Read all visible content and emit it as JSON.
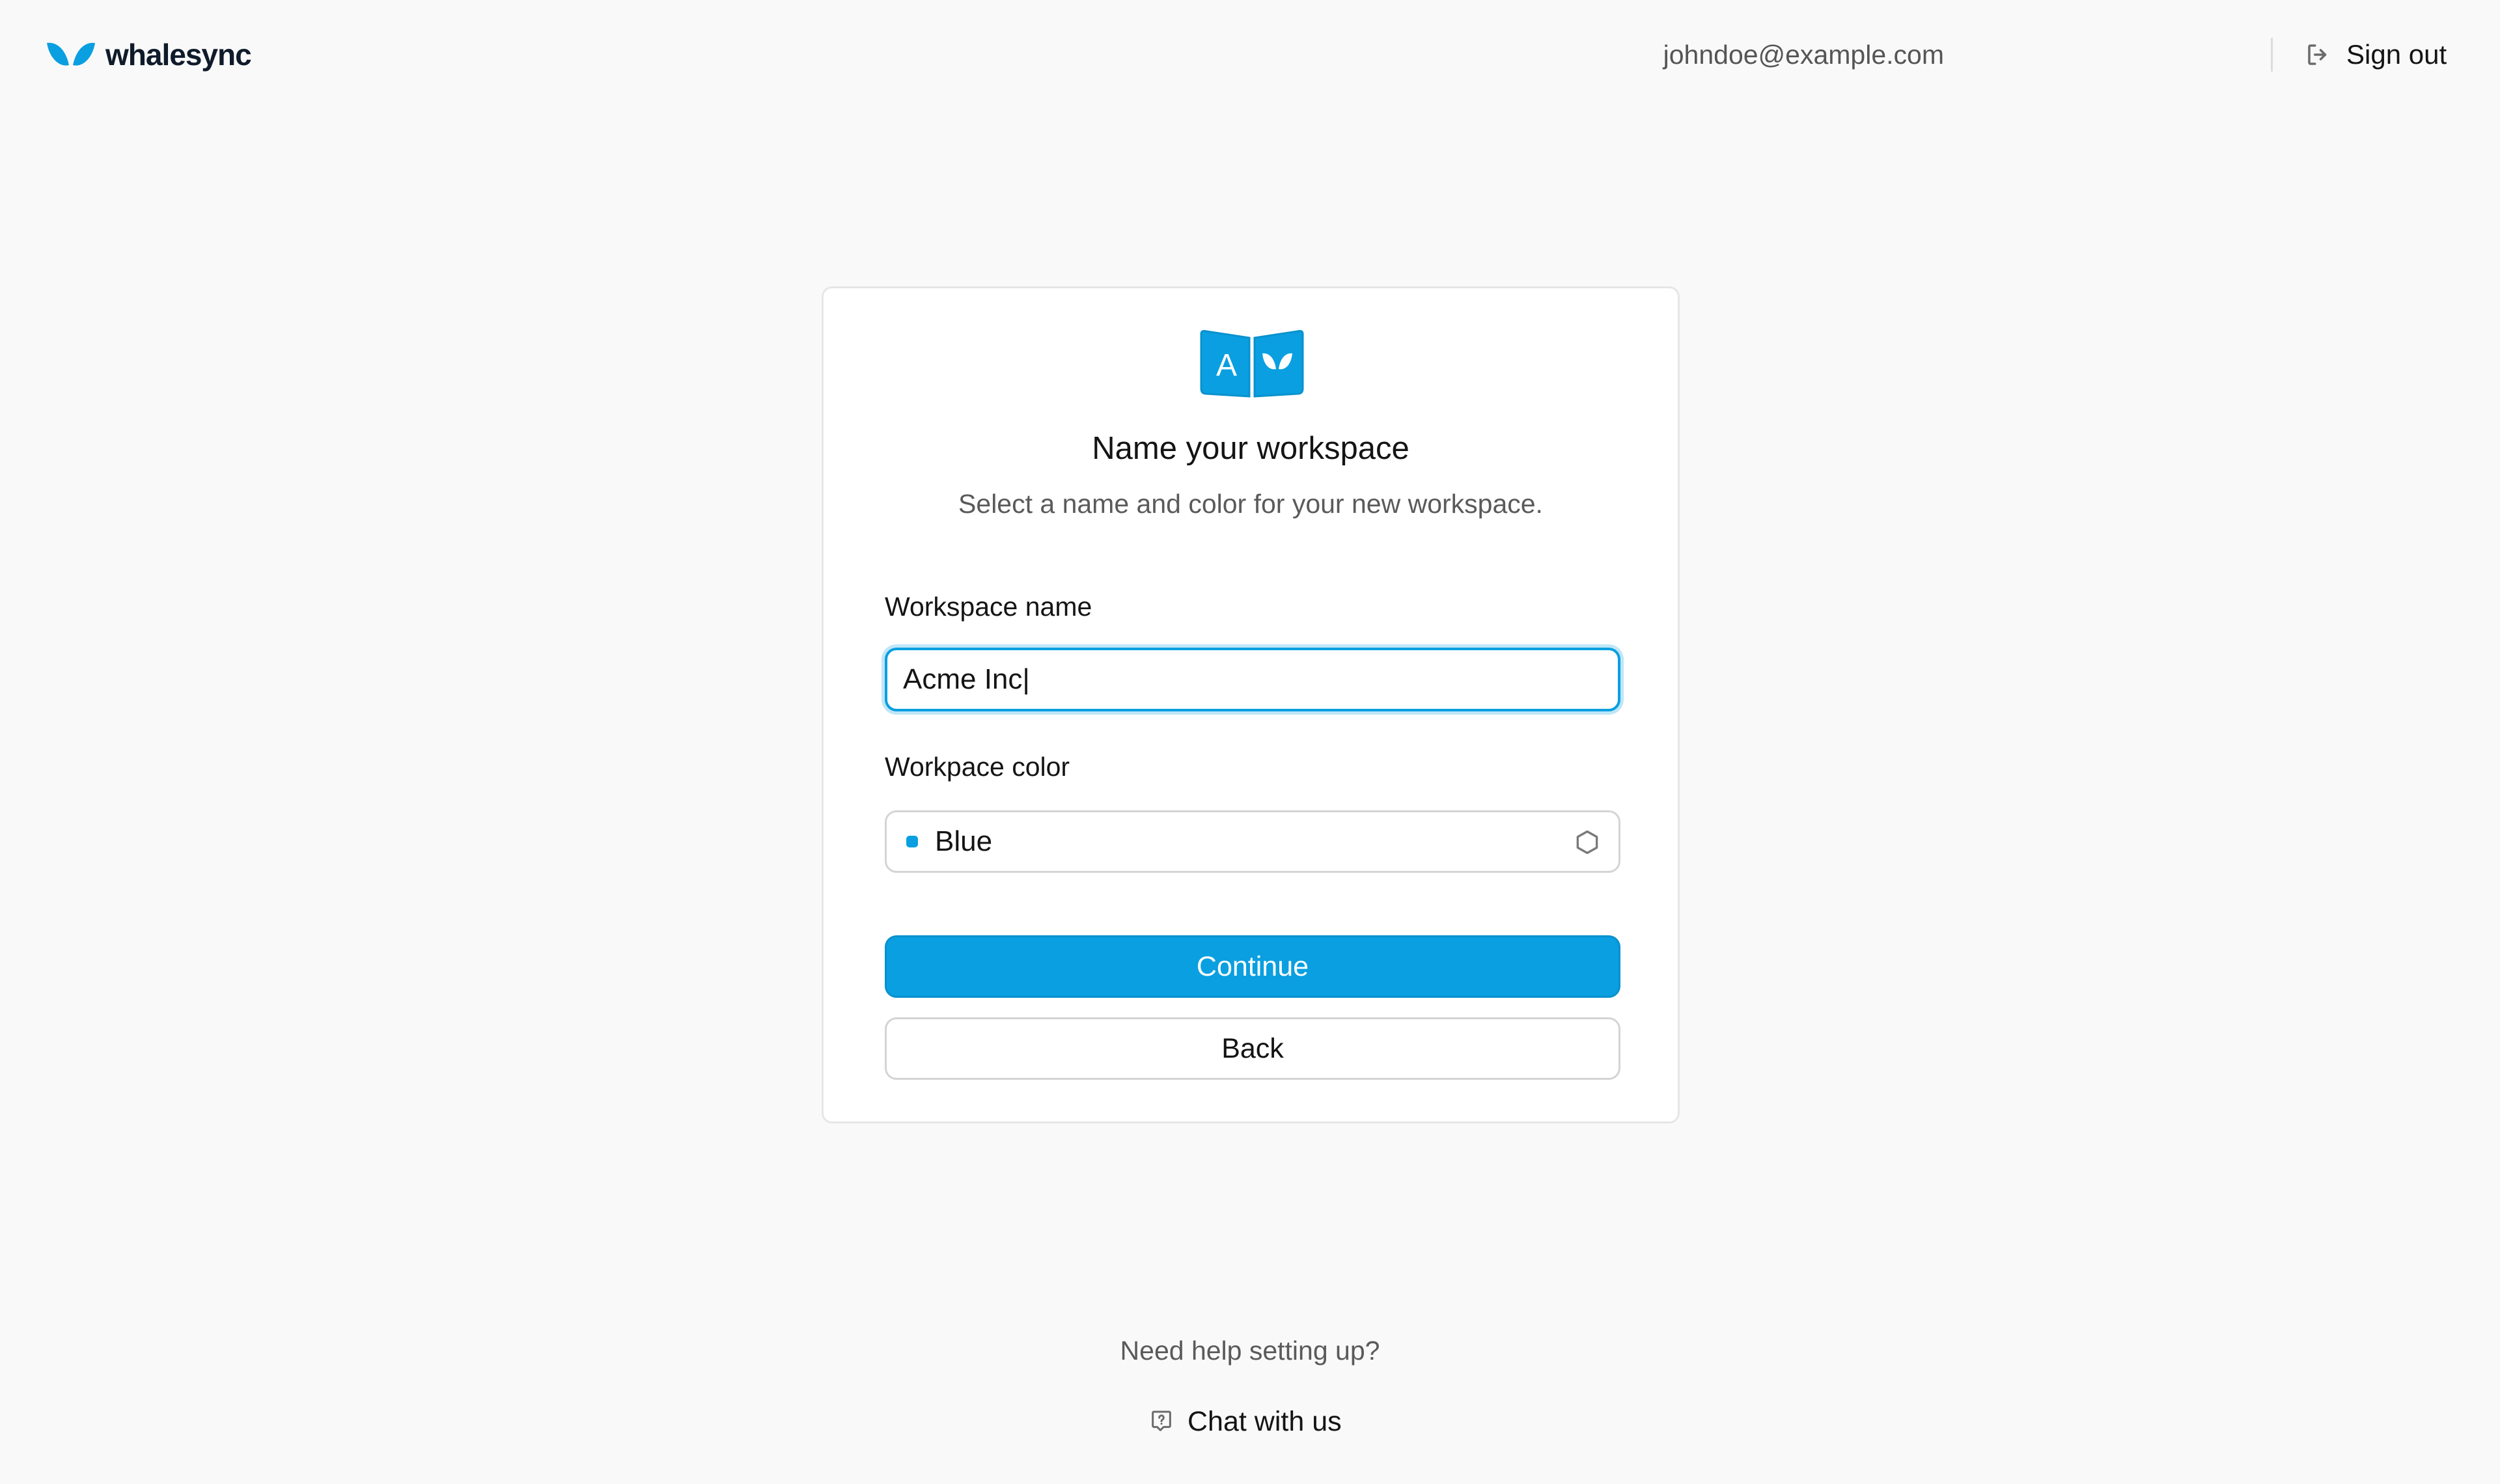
{
  "header": {
    "brand_name": "whalesync",
    "user_email": "johndoe@example.com",
    "sign_out_label": "Sign out",
    "brand_color": "#0a9fe0"
  },
  "card": {
    "workspace_icon_letter": "A",
    "title": "Name your workspace",
    "subtitle": "Select a name and color for your new workspace.",
    "name_field": {
      "label": "Workspace name",
      "value": "Acme Inc|"
    },
    "color_field": {
      "label": "Workpace color",
      "value": "Blue",
      "swatch_color": "#0a9fe0"
    },
    "continue_label": "Continue",
    "back_label": "Back"
  },
  "footer": {
    "help_text": "Need help setting up?",
    "chat_label": "Chat with us"
  },
  "icons": [
    "whalesync-logo-icon",
    "sign-out-icon",
    "workspace-avatar-icon",
    "select-chevron-icon",
    "chat-help-icon"
  ]
}
